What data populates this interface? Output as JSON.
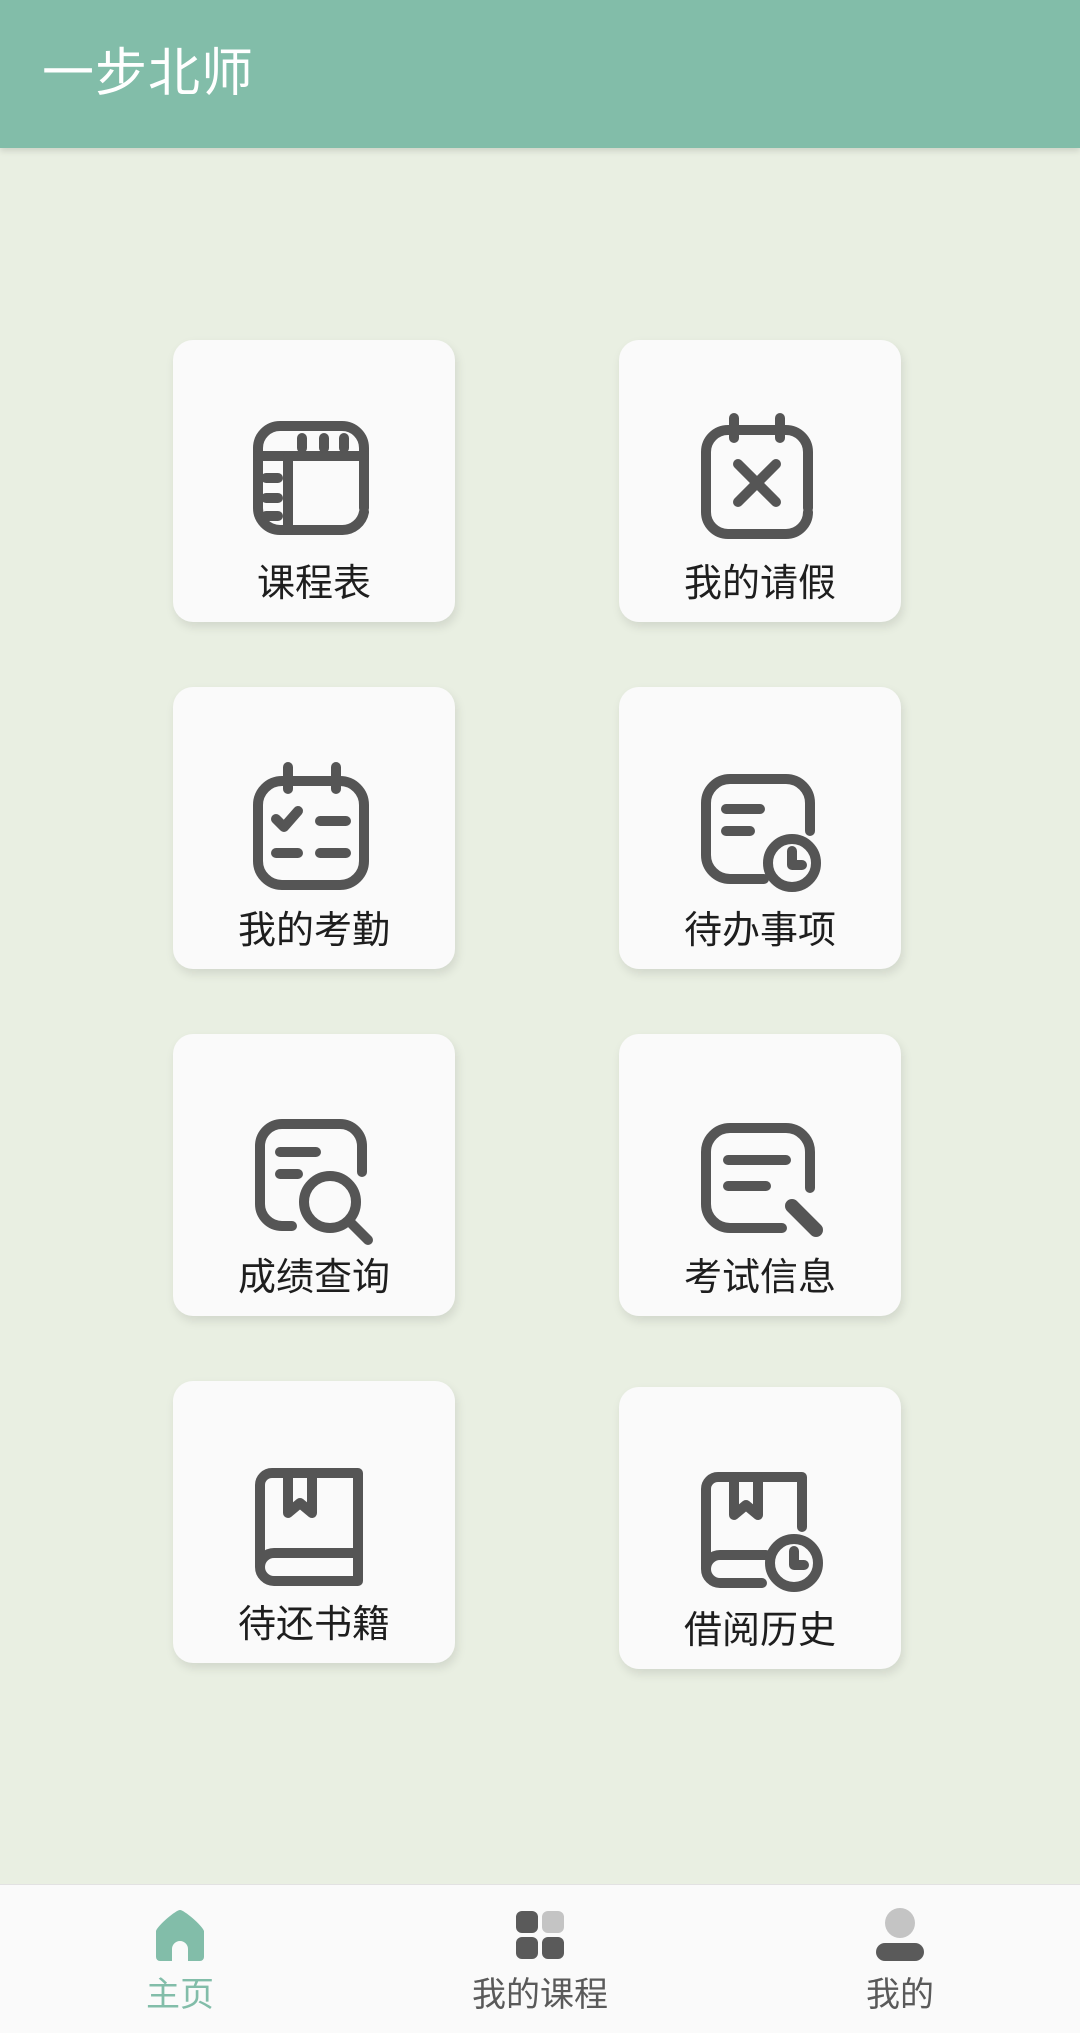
{
  "header": {
    "title": "一步北师"
  },
  "grid": {
    "items": [
      {
        "label": "课程表",
        "icon": "timetable-icon"
      },
      {
        "label": "我的请假",
        "icon": "calendar-cancel-icon"
      },
      {
        "label": "我的考勤",
        "icon": "calendar-check-icon"
      },
      {
        "label": "待办事项",
        "icon": "todo-clock-icon"
      },
      {
        "label": "成绩查询",
        "icon": "document-search-icon"
      },
      {
        "label": "考试信息",
        "icon": "document-edit-icon"
      },
      {
        "label": "待还书籍",
        "icon": "book-icon"
      },
      {
        "label": "借阅历史",
        "icon": "book-history-icon"
      }
    ]
  },
  "bottom_nav": {
    "items": [
      {
        "label": "主页",
        "icon": "home-icon",
        "active": true
      },
      {
        "label": "我的课程",
        "icon": "grid-apps-icon",
        "active": false
      },
      {
        "label": "我的",
        "icon": "person-icon",
        "active": false
      }
    ]
  },
  "colors": {
    "accent": "#82bda9",
    "background": "#e9efe2",
    "icon_stroke": "#555555",
    "nav_inactive": "#5a5a5a"
  }
}
